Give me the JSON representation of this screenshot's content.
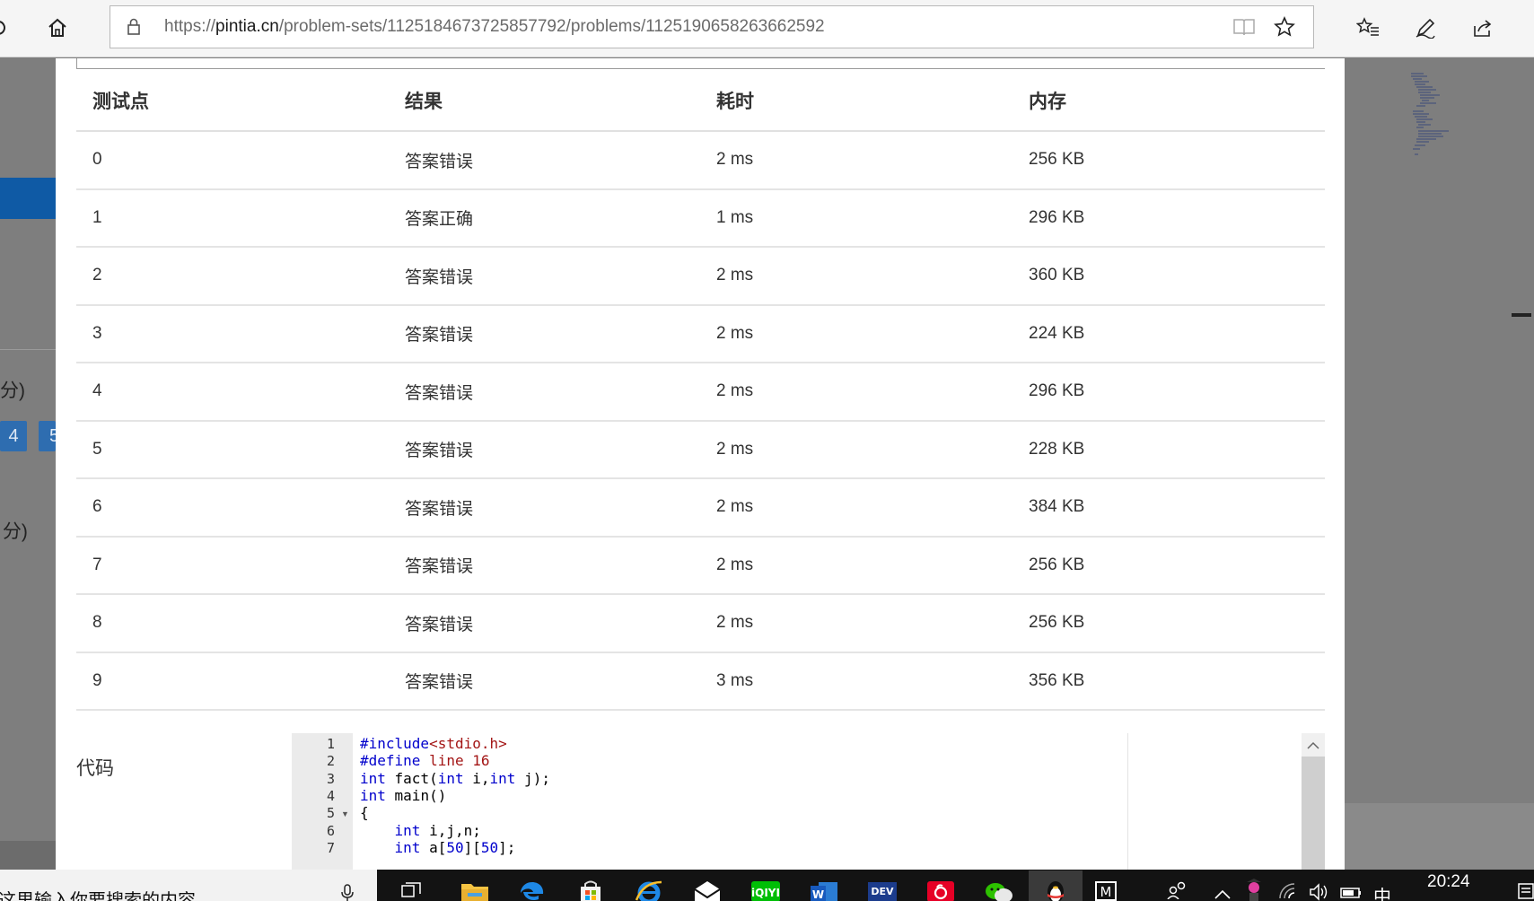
{
  "browser": {
    "url_prefix": "https://",
    "url_domain": "pintia.cn",
    "url_path": "/problem-sets/1125184673725857792/problems/1125190658263662592"
  },
  "background": {
    "score_text_1": "分)",
    "score_text_2": ") 分)",
    "chip_4": "4",
    "chip_5": "5"
  },
  "results_table": {
    "headers": [
      "测试点",
      "结果",
      "耗时",
      "内存"
    ],
    "rows": [
      {
        "id": "0",
        "result": "答案错误",
        "status": "wrong",
        "time": "2 ms",
        "memory": "256 KB"
      },
      {
        "id": "1",
        "result": "答案正确",
        "status": "right",
        "time": "1 ms",
        "memory": "296 KB"
      },
      {
        "id": "2",
        "result": "答案错误",
        "status": "wrong",
        "time": "2 ms",
        "memory": "360 KB"
      },
      {
        "id": "3",
        "result": "答案错误",
        "status": "wrong",
        "time": "2 ms",
        "memory": "224 KB"
      },
      {
        "id": "4",
        "result": "答案错误",
        "status": "wrong",
        "time": "2 ms",
        "memory": "296 KB"
      },
      {
        "id": "5",
        "result": "答案错误",
        "status": "wrong",
        "time": "2 ms",
        "memory": "228 KB"
      },
      {
        "id": "6",
        "result": "答案错误",
        "status": "wrong",
        "time": "2 ms",
        "memory": "384 KB"
      },
      {
        "id": "7",
        "result": "答案错误",
        "status": "wrong",
        "time": "2 ms",
        "memory": "256 KB"
      },
      {
        "id": "8",
        "result": "答案错误",
        "status": "wrong",
        "time": "2 ms",
        "memory": "256 KB"
      },
      {
        "id": "9",
        "result": "答案错误",
        "status": "wrong",
        "time": "3 ms",
        "memory": "356 KB"
      }
    ]
  },
  "code": {
    "label": "代码",
    "lines": [
      {
        "n": "1",
        "text": "#include<stdio.h>"
      },
      {
        "n": "2",
        "text": "#define line 16"
      },
      {
        "n": "3",
        "text": "int fact(int i,int j);"
      },
      {
        "n": "4",
        "text": "int main()"
      },
      {
        "n": "5",
        "text": "{"
      },
      {
        "n": "6",
        "text": "    int i,j,n;"
      },
      {
        "n": "7",
        "text": "    int a[50][50];"
      }
    ]
  },
  "taskbar": {
    "search_placeholder": "在这里输入你要搜索的内容",
    "ime": "中",
    "time": "20:24",
    "apps": [
      "task-view",
      "file-explorer",
      "edge",
      "store",
      "internet-explorer",
      "mail",
      "iqiyi",
      "word",
      "dev-cpp",
      "netease-music",
      "wechat",
      "qq",
      "m-app"
    ]
  },
  "colors": {
    "status_wrong": "#43a047",
    "status_right": "#e53935",
    "bg_blue_bar": "#0f5aa5"
  }
}
